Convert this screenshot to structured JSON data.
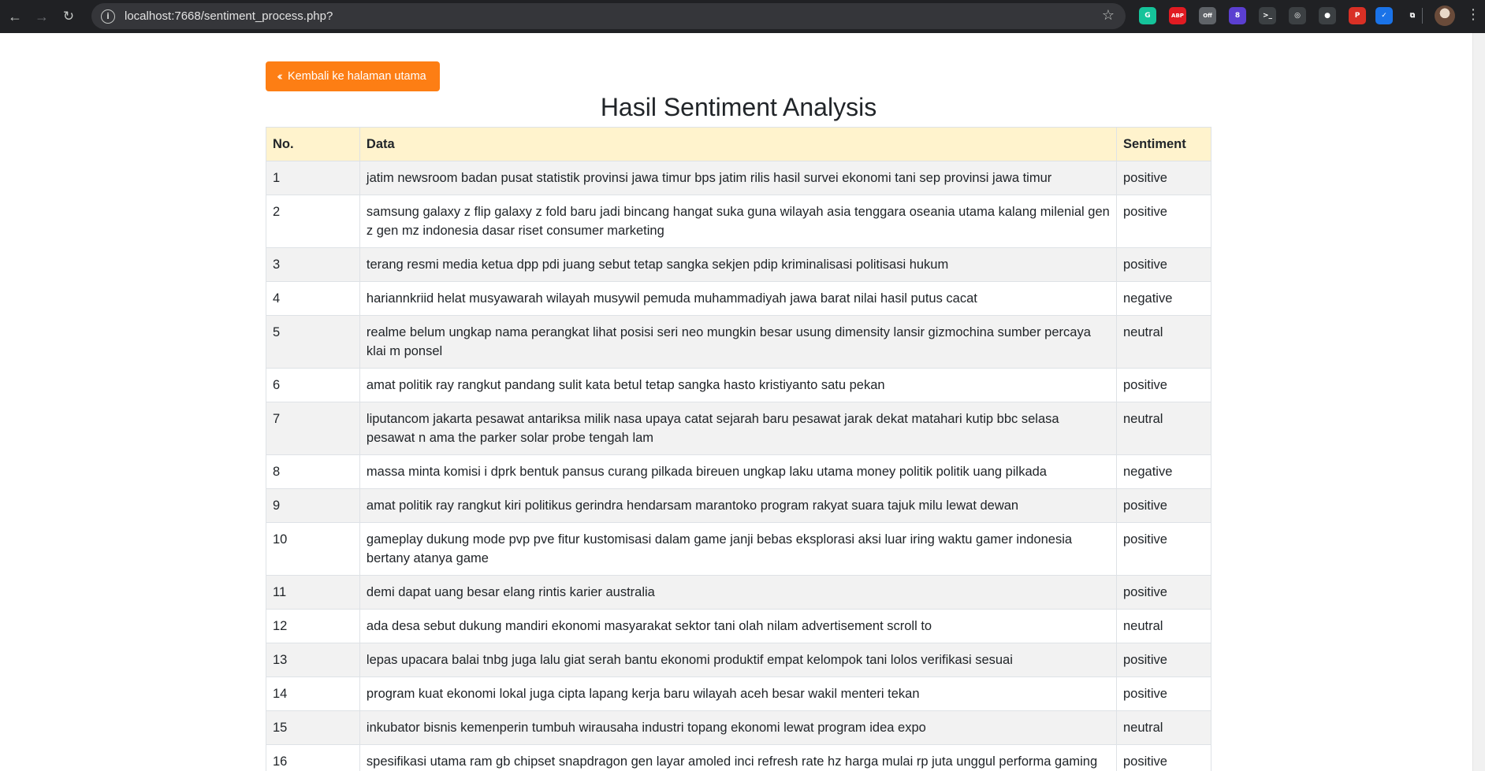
{
  "browser": {
    "url": "localhost:7668/sentiment_process.php?"
  },
  "extensions": [
    {
      "name": "grammarly-extension-icon",
      "color": "#15c39a",
      "glyph": "G"
    },
    {
      "name": "adblock-plus-extension-icon",
      "color": "#e11b22",
      "glyph": "ABP"
    },
    {
      "name": "off-extension-icon",
      "color": "#5f6368",
      "glyph": "Off"
    },
    {
      "name": "purple-extension-icon",
      "color": "#5b3fd1",
      "glyph": "8"
    },
    {
      "name": "terminal-extension-icon",
      "color": "#3c4043",
      "glyph": ">_"
    },
    {
      "name": "target-extension-icon",
      "color": "#3c4043",
      "glyph": "◎"
    },
    {
      "name": "robot-extension-icon",
      "color": "#3c4043",
      "glyph": "●"
    },
    {
      "name": "p-extension-icon",
      "color": "#d93025",
      "glyph": "P"
    },
    {
      "name": "checkmark-extension-icon",
      "color": "#1a73e8",
      "glyph": "✓"
    },
    {
      "name": "puzzle-extension-icon",
      "color": "#202124",
      "glyph": "⧉"
    }
  ],
  "back_button": {
    "label": "Kembali ke halaman utama"
  },
  "page_title": "Hasil Sentiment Analysis",
  "table": {
    "headers": [
      "No.",
      "Data",
      "Sentiment"
    ],
    "rows": [
      {
        "no": "1",
        "data": "jatim newsroom badan pusat statistik provinsi jawa timur bps jatim rilis hasil survei ekonomi tani sep provinsi jawa timur",
        "sentiment": "positive"
      },
      {
        "no": "2",
        "data": "samsung galaxy z flip galaxy z fold baru jadi bincang hangat suka guna wilayah asia tenggara oseania utama kalang milenial gen z gen mz indonesia dasar riset consumer marketing",
        "sentiment": "positive"
      },
      {
        "no": "3",
        "data": "terang resmi media ketua dpp pdi juang sebut tetap sangka sekjen pdip kriminalisasi politisasi hukum",
        "sentiment": "positive"
      },
      {
        "no": "4",
        "data": "hariannkriid helat musyawarah wilayah musywil pemuda muhammadiyah jawa barat nilai hasil putus cacat",
        "sentiment": "negative"
      },
      {
        "no": "5",
        "data": "realme belum ungkap nama perangkat lihat posisi seri neo mungkin besar usung dimensity lansir gizmochina sumber percaya klai m ponsel",
        "sentiment": "neutral"
      },
      {
        "no": "6",
        "data": "amat politik ray rangkut pandang sulit kata betul tetap sangka hasto kristiyanto satu pekan",
        "sentiment": "positive"
      },
      {
        "no": "7",
        "data": "liputancom jakarta pesawat antariksa milik nasa upaya catat sejarah baru pesawat jarak dekat matahari kutip bbc selasa pesawat n ama the parker solar probe tengah lam",
        "sentiment": "neutral"
      },
      {
        "no": "8",
        "data": "massa minta komisi i dprk bentuk pansus curang pilkada bireuen ungkap laku utama money politik politik uang pilkada",
        "sentiment": "negative"
      },
      {
        "no": "9",
        "data": "amat politik ray rangkut kiri politikus gerindra hendarsam marantoko program rakyat suara tajuk milu lewat dewan",
        "sentiment": "positive"
      },
      {
        "no": "10",
        "data": "gameplay dukung mode pvp pve fitur kustomisasi dalam game janji bebas eksplorasi aksi luar iring waktu gamer indonesia bertany atanya game",
        "sentiment": "positive"
      },
      {
        "no": "11",
        "data": "demi dapat uang besar elang rintis karier australia",
        "sentiment": "positive"
      },
      {
        "no": "12",
        "data": "ada desa sebut dukung mandiri ekonomi masyarakat sektor tani olah nilam advertisement scroll to",
        "sentiment": "neutral"
      },
      {
        "no": "13",
        "data": "lepas upacara balai tnbg juga lalu giat serah bantu ekonomi produktif empat kelompok tani lolos verifikasi sesuai",
        "sentiment": "positive"
      },
      {
        "no": "14",
        "data": "program kuat ekonomi lokal juga cipta lapang kerja baru wilayah aceh besar wakil menteri tekan",
        "sentiment": "positive"
      },
      {
        "no": "15",
        "data": "inkubator bisnis kemenperin tumbuh wirausaha industri topang ekonomi lewat program idea expo",
        "sentiment": "neutral"
      },
      {
        "no": "16",
        "data": "spesifikasi utama ram gb chipset snapdragon gen layar amoled inci refresh rate hz harga mulai rp juta unggul performa gaming tin ggi fitur",
        "sentiment": "positive"
      }
    ]
  }
}
